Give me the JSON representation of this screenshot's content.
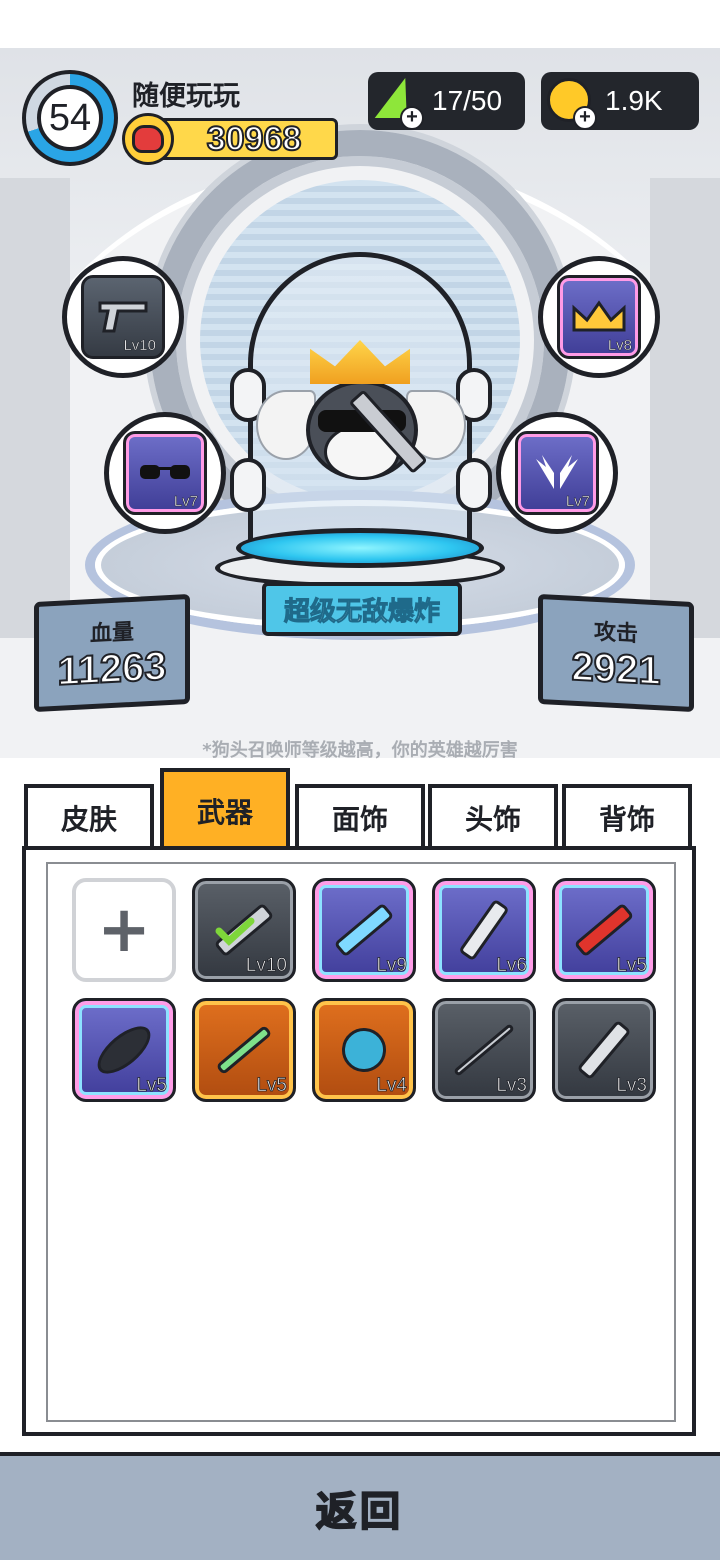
{
  "player": {
    "level": "54",
    "name": "随便玩玩",
    "power": "30968"
  },
  "resources": {
    "energy": "17/50",
    "gold": "1.9K"
  },
  "equipment": [
    {
      "slot": "weapon",
      "icon": "pistol-icon",
      "level": "Lv10"
    },
    {
      "slot": "face",
      "icon": "sunglasses-icon",
      "level": "Lv7"
    },
    {
      "slot": "head",
      "icon": "crown-icon",
      "level": "Lv8"
    },
    {
      "slot": "back",
      "icon": "wings-icon",
      "level": "Lv7"
    }
  ],
  "hero": {
    "title": "超级无敌爆炸",
    "hp_label": "血量",
    "hp_value": "11263",
    "atk_label": "攻击",
    "atk_value": "2921"
  },
  "hint": "*狗头召唤师等级越高，你的英雄越厉害",
  "tabs": [
    {
      "label": "皮肤",
      "active": false
    },
    {
      "label": "武器",
      "active": true
    },
    {
      "label": "面饰",
      "active": false
    },
    {
      "label": "头饰",
      "active": false
    },
    {
      "label": "背饰",
      "active": false
    }
  ],
  "items": [
    {
      "icon": "add-icon",
      "level": "",
      "rarity": "add"
    },
    {
      "icon": "pistol-icon",
      "level": "Lv10",
      "rarity": "gray",
      "equipped": true
    },
    {
      "icon": "surfboard-icon",
      "level": "Lv9",
      "rarity": "purple"
    },
    {
      "icon": "blade-icon",
      "level": "Lv6",
      "rarity": "purple"
    },
    {
      "icon": "red-sword-icon",
      "level": "Lv5",
      "rarity": "purple"
    },
    {
      "icon": "frying-pan-icon",
      "level": "Lv5",
      "rarity": "purple"
    },
    {
      "icon": "syringe-icon",
      "level": "Lv5",
      "rarity": "orange"
    },
    {
      "icon": "gourd-icon",
      "level": "Lv4",
      "rarity": "orange"
    },
    {
      "icon": "spear-icon",
      "level": "Lv3",
      "rarity": "gray"
    },
    {
      "icon": "sabre-icon",
      "level": "Lv3",
      "rarity": "gray"
    }
  ],
  "footer": {
    "back_label": "返回"
  }
}
